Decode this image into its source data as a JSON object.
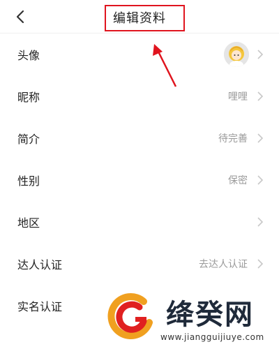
{
  "header": {
    "back_icon": "chevron-left-icon",
    "title": "编辑资料"
  },
  "rows": [
    {
      "label": "头像",
      "value": "",
      "type": "avatar"
    },
    {
      "label": "昵称",
      "value": "哩哩"
    },
    {
      "label": "简介",
      "value": "待完善"
    },
    {
      "label": "性别",
      "value": "保密"
    },
    {
      "label": "地区",
      "value": ""
    },
    {
      "label": "达人认证",
      "value": "去达人认证"
    },
    {
      "label": "实名认证",
      "value": ""
    }
  ],
  "colors": {
    "annotation": "#e0141e",
    "label_text": "#222222",
    "value_text": "#9a9a9a",
    "chevron": "#c8c8c8"
  },
  "watermark": {
    "title": "绛癸网",
    "url": "www.jiangguijiuye.com"
  }
}
